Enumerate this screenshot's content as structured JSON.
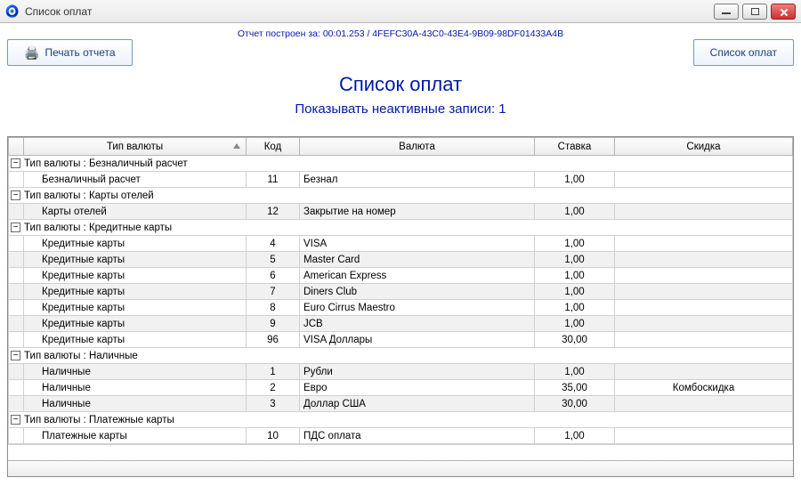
{
  "window": {
    "title": "Список оплат"
  },
  "report_info": "Отчет построен за: 00:01.253 / 4FEFC30A-43C0-43E4-9B09-98DF01433A4B",
  "buttons": {
    "print": "Печать отчета",
    "list": "Список оплат"
  },
  "header": {
    "title": "Список оплат",
    "subtitle": "Показывать неактивные записи: 1"
  },
  "columns": {
    "type": "Тип валюты",
    "code": "Код",
    "currency": "Валюта",
    "rate": "Ставка",
    "discount": "Скидка"
  },
  "groups": [
    {
      "label": "Тип валюты : Безналичный расчет",
      "rows": [
        {
          "type": "Безналичный расчет",
          "code": "11",
          "currency": "Безнал",
          "rate": "1,00",
          "discount": ""
        }
      ]
    },
    {
      "label": "Тип валюты : Карты отелей",
      "rows": [
        {
          "type": "Карты отелей",
          "code": "12",
          "currency": "Закрытие на номер",
          "rate": "1,00",
          "discount": ""
        }
      ]
    },
    {
      "label": "Тип валюты : Кредитные карты",
      "rows": [
        {
          "type": "Кредитные карты",
          "code": "4",
          "currency": "VISA",
          "rate": "1,00",
          "discount": ""
        },
        {
          "type": "Кредитные карты",
          "code": "5",
          "currency": "Master Card",
          "rate": "1,00",
          "discount": ""
        },
        {
          "type": "Кредитные карты",
          "code": "6",
          "currency": "American Express",
          "rate": "1,00",
          "discount": ""
        },
        {
          "type": "Кредитные карты",
          "code": "7",
          "currency": "Diners Club",
          "rate": "1,00",
          "discount": ""
        },
        {
          "type": "Кредитные карты",
          "code": "8",
          "currency": "Euro Cirrus Maestro",
          "rate": "1,00",
          "discount": ""
        },
        {
          "type": "Кредитные карты",
          "code": "9",
          "currency": "JCB",
          "rate": "1,00",
          "discount": ""
        },
        {
          "type": "Кредитные карты",
          "code": "96",
          "currency": "VISA Доллары",
          "rate": "30,00",
          "discount": ""
        }
      ]
    },
    {
      "label": "Тип валюты : Наличные",
      "rows": [
        {
          "type": "Наличные",
          "code": "1",
          "currency": "Рубли",
          "rate": "1,00",
          "discount": ""
        },
        {
          "type": "Наличные",
          "code": "2",
          "currency": "Евро",
          "rate": "35,00",
          "discount": "Комбоскидка"
        },
        {
          "type": "Наличные",
          "code": "3",
          "currency": "Доллар США",
          "rate": "30,00",
          "discount": ""
        }
      ]
    },
    {
      "label": "Тип валюты : Платежные карты",
      "rows": [
        {
          "type": "Платежные карты",
          "code": "10",
          "currency": "ПДС оплата",
          "rate": "1,00",
          "discount": ""
        }
      ]
    }
  ]
}
